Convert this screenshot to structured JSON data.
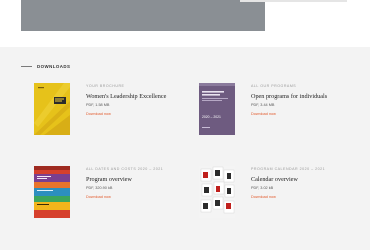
{
  "section": {
    "title": "DOWNLOADS"
  },
  "downloads": [
    {
      "eyebrow": "YOUR BROCHURE",
      "title": "Women's Leadership Excellence",
      "meta": "PDF, 1.58 MB",
      "link": "Download now",
      "cover_color": "#e6c21a"
    },
    {
      "eyebrow": "ALL OUR PROGRAMS",
      "title": "Open programs for individuals",
      "meta": "PDF, 3.44 MB",
      "link": "Download now",
      "cover_color": "#6e5b80",
      "cover_text": "2020 – 2021"
    },
    {
      "eyebrow": "ALL DATES AND COSTS 2020 – 2021",
      "title": "Program overview",
      "meta": "PDF, 320.90 kB",
      "link": "Download now",
      "cover_color": "#d6402c"
    },
    {
      "eyebrow": "PROGRAM CALENDAR 2020 – 2021",
      "title": "Calendar overview",
      "meta": "PDF, 3.02 kB",
      "link": "Download now",
      "cover_color": "#f4f4f4"
    }
  ]
}
